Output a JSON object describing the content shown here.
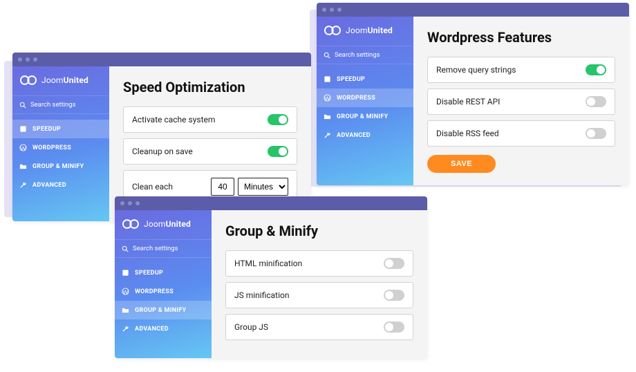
{
  "brand": {
    "name_a": "Joom",
    "name_b": "United"
  },
  "sidebar": {
    "search_placeholder": "Search settings",
    "items": [
      "SPEEDUP",
      "WORDPRESS",
      "GROUP & MINIFY",
      "ADVANCED"
    ]
  },
  "win1": {
    "title": "Speed Optimization",
    "row1": "Activate cache system",
    "row2": "Cleanup on save",
    "row3": "Clean each",
    "value": "40",
    "unit": "Minutes"
  },
  "win2": {
    "title": "Wordpress Features",
    "row1": "Remove query strings",
    "row2": "Disable REST API",
    "row3": "Disable RSS feed",
    "save": "SAVE"
  },
  "win3": {
    "title": "Group & Minify",
    "row1": "HTML minification",
    "row2": "JS minification",
    "row3": "Group JS"
  }
}
